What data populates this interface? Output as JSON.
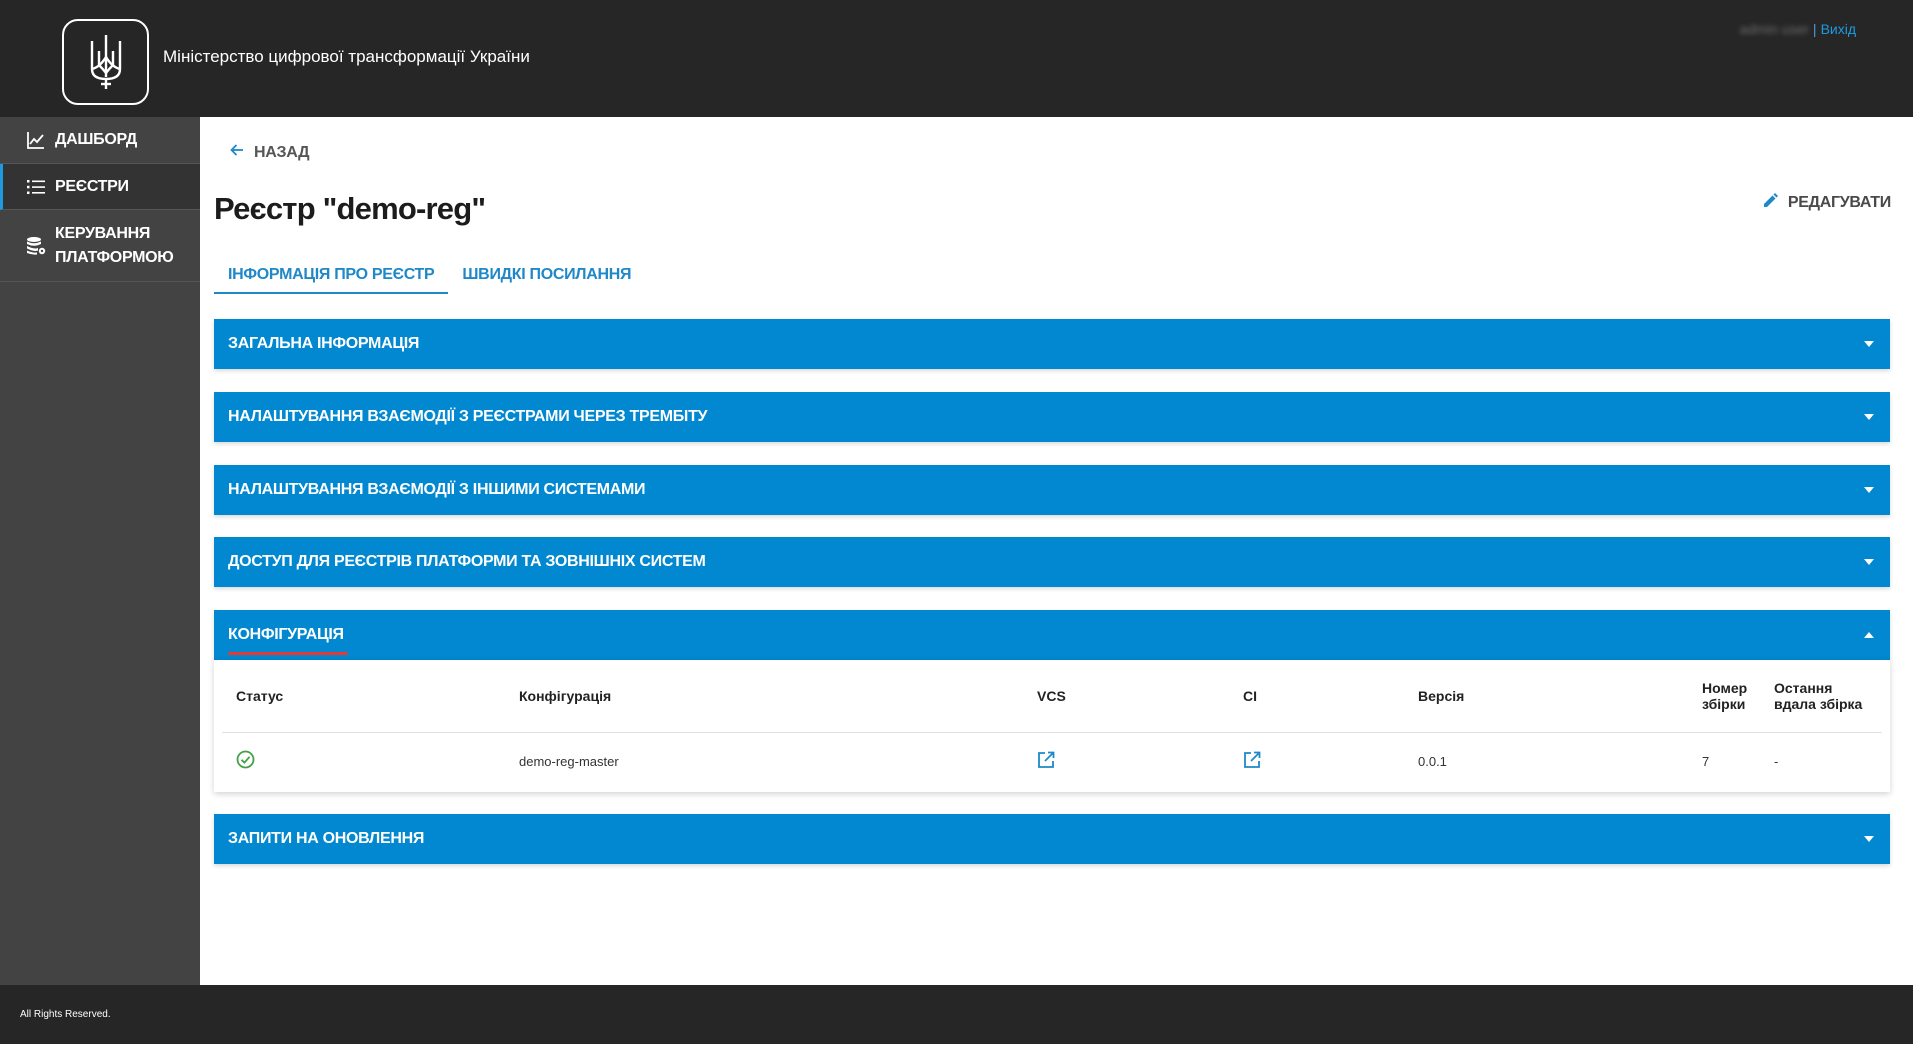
{
  "header": {
    "org_title": "Міністерство цифрової трансформації України",
    "user_name": "admin user",
    "separator": "|",
    "logout_label": "Вихід"
  },
  "sidebar": {
    "items": [
      {
        "label": "Дашборд",
        "icon": "chart-icon"
      },
      {
        "label": "Реєстри",
        "icon": "list-icon",
        "active": true
      },
      {
        "label_line1": "Керування",
        "label_line2": "платформою",
        "icon": "database-settings-icon"
      }
    ]
  },
  "main": {
    "back_label": "НАЗАД",
    "title": "Реєстр \"demo-reg\"",
    "edit_label": "РЕДАГУВАТИ",
    "tabs": [
      {
        "label": "ІНФОРМАЦІЯ ПРО РЕЄСТР",
        "active": true
      },
      {
        "label": "ШВИДКІ ПОСИЛАННЯ",
        "active": false
      }
    ],
    "sections": [
      {
        "title": "Загальна інформація",
        "expanded": false
      },
      {
        "title": "Налаштування взаємодії з реєстрами через Трембіту",
        "expanded": false
      },
      {
        "title": "Налаштування взаємодії з іншими системами",
        "expanded": false
      },
      {
        "title": "Доступ для реєстрів платформи та зовнішніх систем",
        "expanded": false
      },
      {
        "title": "Конфігурація",
        "expanded": true
      },
      {
        "title": "Запити на оновлення",
        "expanded": false
      }
    ],
    "config_table": {
      "headers": {
        "status": "Статус",
        "configuration": "Конфігурація",
        "vcs": "VCS",
        "ci": "CI",
        "version": "Версія",
        "build_number_line1": "Номер",
        "build_number_line2": "збірки",
        "last_success_line1": "Остання",
        "last_success_line2": "вдала збірка"
      },
      "rows": [
        {
          "status": "success",
          "configuration": "demo-reg-master",
          "version": "0.0.1",
          "build_number": "7",
          "last_success": "-"
        }
      ]
    }
  },
  "footer": {
    "text": "All Rights Reserved."
  },
  "colors": {
    "accent": "#0288d1",
    "header_bg": "#262626",
    "sidebar_bg": "#434343",
    "success": "#43a047"
  }
}
